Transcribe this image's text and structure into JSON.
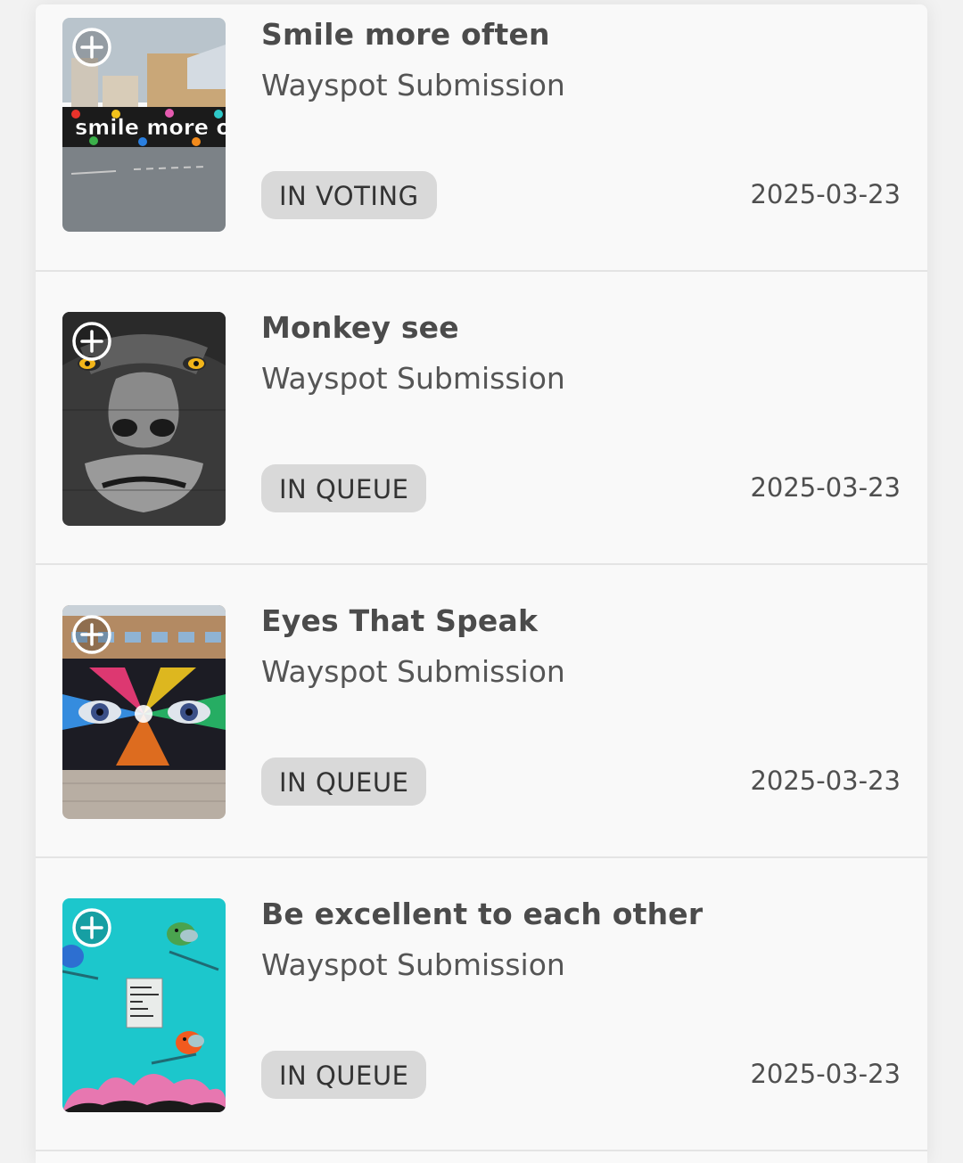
{
  "submissions": [
    {
      "title": "Smile more often",
      "type": "Wayspot Submission",
      "status": "IN VOTING",
      "date": "2025-03-23",
      "thumbnail_icon": "mural-smile-more-often-photo",
      "thumbnail_text": "smile more ofte"
    },
    {
      "title": "Monkey see",
      "type": "Wayspot Submission",
      "status": "IN QUEUE",
      "date": "2025-03-23",
      "thumbnail_icon": "mural-gorilla-photo"
    },
    {
      "title": "Eyes That Speak",
      "type": "Wayspot Submission",
      "status": "IN QUEUE",
      "date": "2025-03-23",
      "thumbnail_icon": "mural-rainbow-eyes-photo"
    },
    {
      "title": "Be excellent to each other",
      "type": "Wayspot Submission",
      "status": "IN QUEUE",
      "date": "2025-03-23",
      "thumbnail_icon": "mural-birds-teal-photo",
      "thumbnail_text": "BE EXCELLENT TO EACH OTHER..."
    }
  ],
  "colors": {
    "page_background": "#f2f2f2",
    "card_background": "#f9f9f9",
    "badge_background": "#d9d9d9",
    "title_text": "#4b4b4b",
    "divider": "#e4e4e4"
  }
}
